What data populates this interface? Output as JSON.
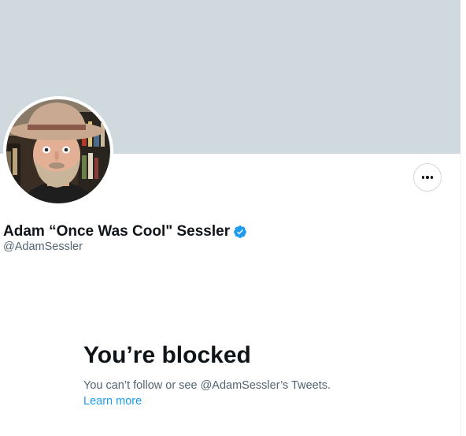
{
  "profile": {
    "display_name": "Adam “Once Was Cool\" Sessler",
    "handle": "@AdamSessler",
    "verified": true,
    "verified_icon": "verified-badge-icon",
    "avatar_icon": "profile-photo"
  },
  "header": {
    "banner_color": "#cfd9de",
    "more_icon": "more-options-icon"
  },
  "blocked": {
    "title": "You’re blocked",
    "description": "You can’t follow or see @AdamSessler’s Tweets.",
    "learn_more": "Learn more"
  },
  "colors": {
    "accent": "#1d9bf0",
    "text_primary": "#0f1419",
    "text_secondary": "#536471"
  }
}
